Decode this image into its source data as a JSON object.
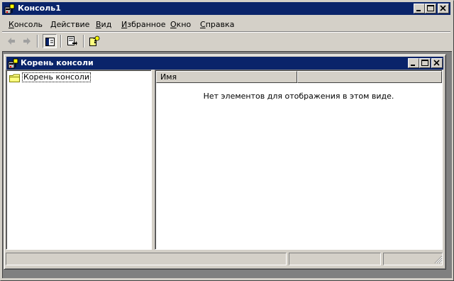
{
  "window": {
    "title": "Консоль1"
  },
  "menu": [
    {
      "label": "Консоль",
      "key": "К"
    },
    {
      "label": "Действие",
      "key": "Д"
    },
    {
      "label": "Вид",
      "key": "В"
    },
    {
      "label": "Избранное",
      "key": "И"
    },
    {
      "label": "Окно",
      "key": "О"
    },
    {
      "label": "Справка",
      "key": "С"
    }
  ],
  "toolbar": {
    "icons": [
      "back-arrow-icon",
      "forward-arrow-icon",
      "show-hide-console-tree-icon",
      "export-list-icon",
      "help-icon"
    ]
  },
  "child_window": {
    "title": "Корень консоли"
  },
  "tree": {
    "root_label": "Корень консоли"
  },
  "list": {
    "columns": [
      "Имя",
      ""
    ],
    "empty_message": "Нет элементов для отображения в этом виде."
  },
  "colors": {
    "titlebar": "#0a246a",
    "face": "#d4d0c8",
    "workspace": "#808080"
  }
}
